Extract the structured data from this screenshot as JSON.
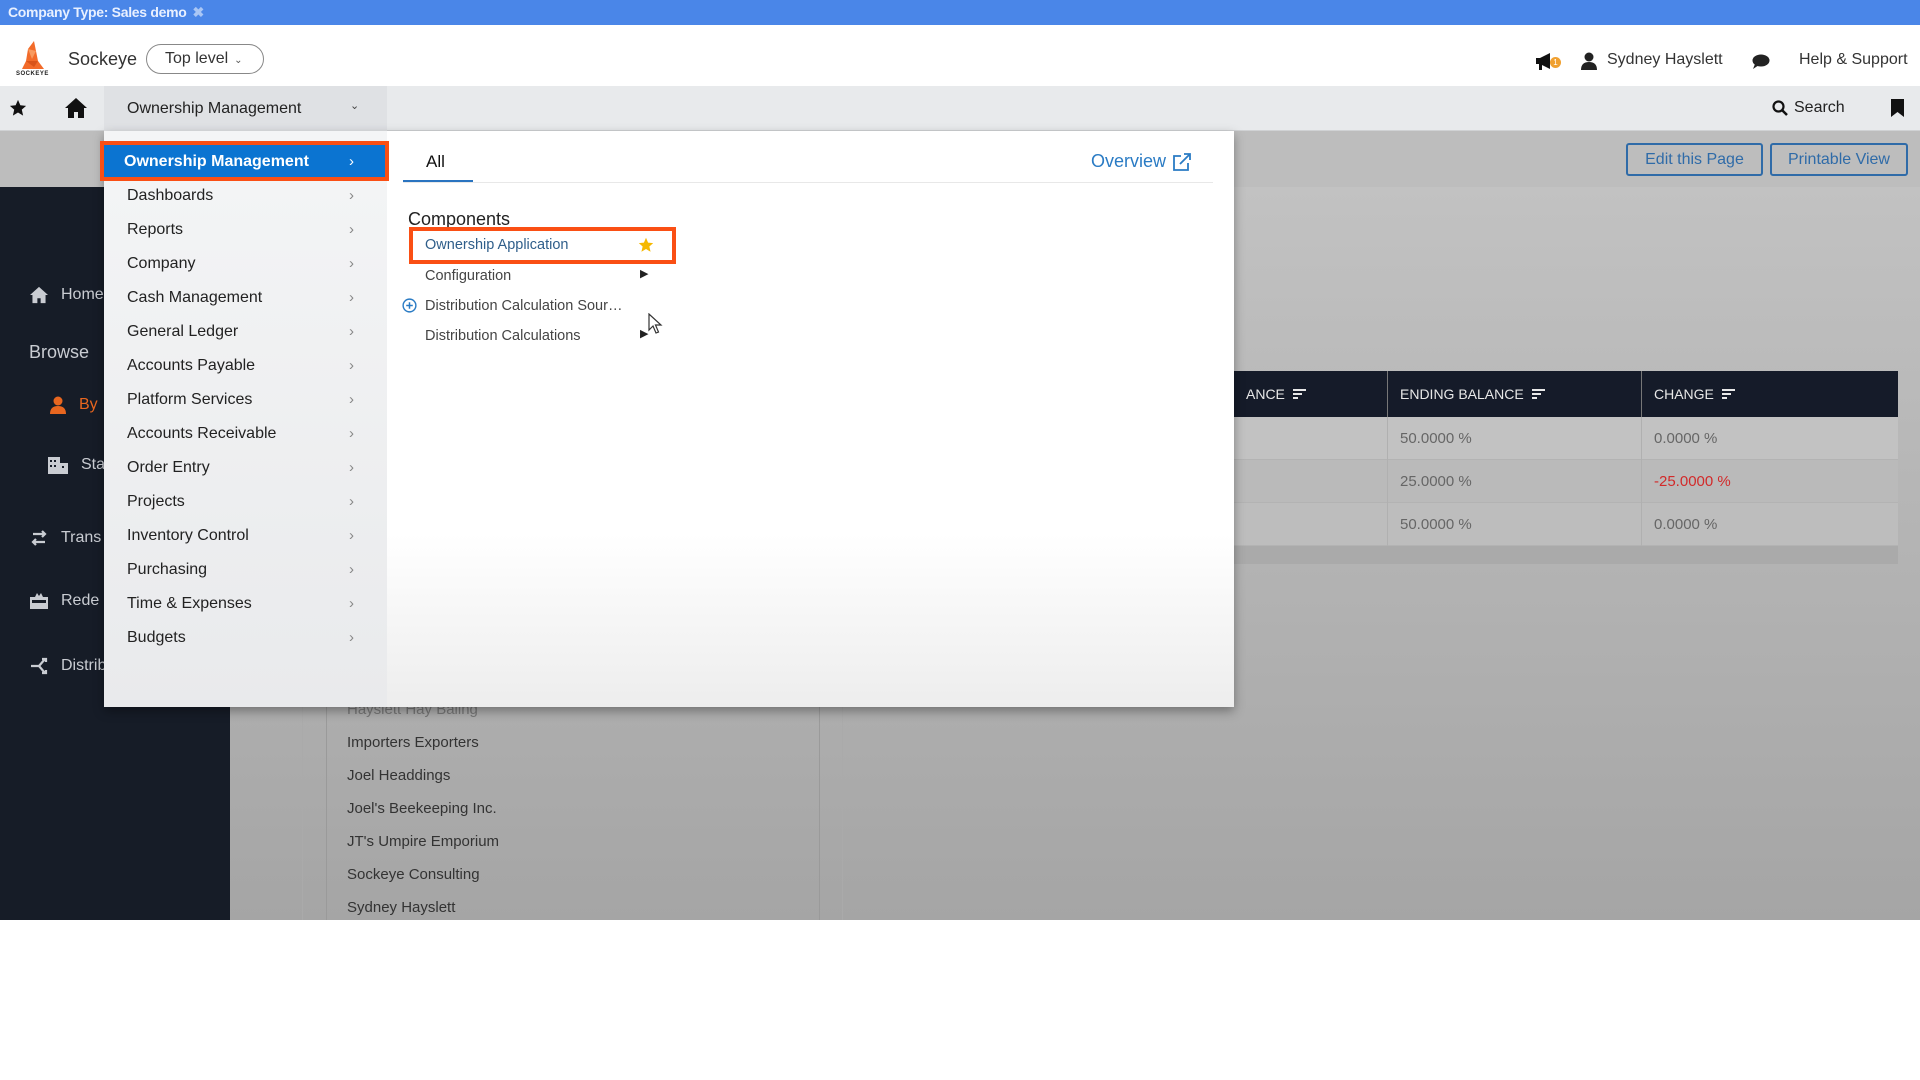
{
  "company_banner": {
    "label": "Company Type: Sales demo",
    "close_icon": "close-icon"
  },
  "header": {
    "brand": "Sockeye",
    "logo_text": "SOCKEYE",
    "level_selector": "Top level",
    "notifications_badge": "1",
    "user_name": "Sydney Hayslett",
    "help_label": "Help & Support"
  },
  "navbar": {
    "module": "Ownership Management",
    "search_label": "Search"
  },
  "actions": {
    "edit_page": "Edit this Page",
    "printable_view": "Printable View"
  },
  "sidebar": {
    "home": "Home",
    "browse": "Browse",
    "items": [
      {
        "label": "By",
        "icon": "user-icon",
        "active": true
      },
      {
        "label": "Sta",
        "icon": "building-icon"
      },
      {
        "label": "Trans",
        "icon": "transfer-icon"
      },
      {
        "label": "Rede",
        "icon": "redeem-icon"
      },
      {
        "label": "Distrib",
        "icon": "distribute-icon"
      }
    ]
  },
  "mega_menu": {
    "modules": [
      {
        "label": "Ownership Management",
        "active": true
      },
      {
        "label": "Dashboards"
      },
      {
        "label": "Reports"
      },
      {
        "label": "Company"
      },
      {
        "label": "Cash Management"
      },
      {
        "label": "General Ledger"
      },
      {
        "label": "Accounts Payable"
      },
      {
        "label": "Platform Services"
      },
      {
        "label": "Accounts Receivable"
      },
      {
        "label": "Order Entry"
      },
      {
        "label": "Projects"
      },
      {
        "label": "Inventory Control"
      },
      {
        "label": "Purchasing"
      },
      {
        "label": "Time & Expenses"
      },
      {
        "label": "Budgets"
      }
    ],
    "tab": "All",
    "overview_link": "Overview",
    "section_heading": "Components",
    "components": [
      {
        "label": "Ownership Application",
        "favorite": true
      },
      {
        "label": "Configuration",
        "submenu": true
      },
      {
        "label": "Distribution Calculation Sour…",
        "add": true
      },
      {
        "label": "Distribution Calculations",
        "submenu": true
      }
    ]
  },
  "table": {
    "headers": [
      "ANCE",
      "ENDING BALANCE",
      "CHANGE"
    ],
    "rows": [
      {
        "ending_balance": "50.0000 %",
        "change": "0.0000 %",
        "negative": false
      },
      {
        "ending_balance": "25.0000 %",
        "change": "-25.0000 %",
        "negative": true
      },
      {
        "ending_balance": "50.0000 %",
        "change": "0.0000 %",
        "negative": false
      }
    ]
  },
  "customer_list": [
    "Hayslett Hay Baling",
    "Importers Exporters",
    "Joel Headdings",
    "Joel's Beekeeping Inc.",
    "JT's Umpire Emporium",
    "Sockeye Consulting",
    "Sydney Hayslett"
  ],
  "colors": {
    "banner": "#4a86e8",
    "accent_blue": "#0b74d1",
    "highlight_box": "#fa4f14",
    "negative": "#d22a2a",
    "sidebar_dark": "#161c27",
    "favorite_star": "#f5b800"
  }
}
